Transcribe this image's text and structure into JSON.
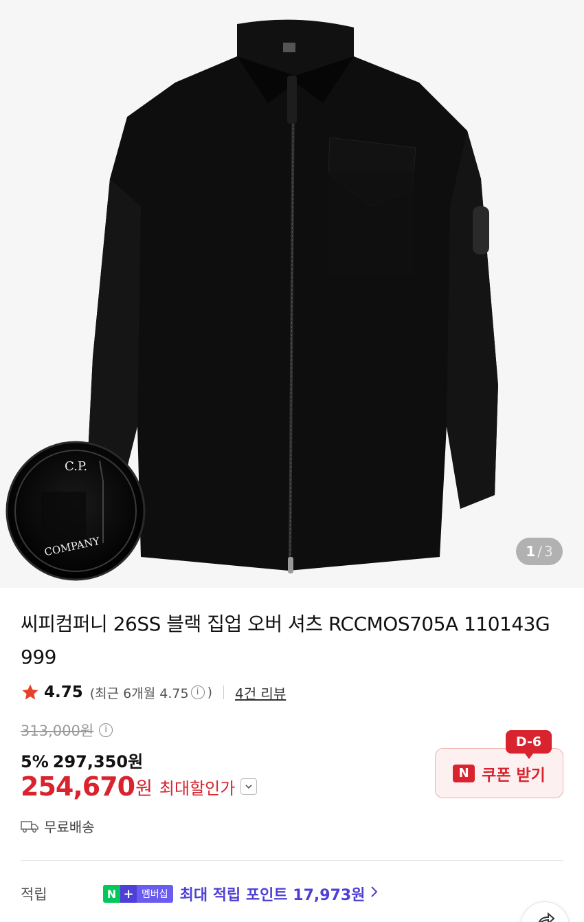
{
  "hero": {
    "image_alt": "black zip overshirt",
    "lens_brand_top": "C.P.",
    "lens_brand_bottom": "COMPANY",
    "page_current": "1",
    "page_separator": "/",
    "page_total": "3"
  },
  "product": {
    "title": "씨피컴퍼니 26SS 블랙 집업 오버 셔츠 RCCMOS705A 110143G 999",
    "rating": "4.75",
    "recent_prefix": "(최근 6개월 4.75",
    "recent_suffix": ")",
    "review_count": "4건 리뷰",
    "original_price": "313,000원",
    "discount_pct": "5%",
    "sale_price": "297,350원",
    "max_price": "254,670",
    "max_price_won": "원",
    "max_label": "최대할인가",
    "shipping": "무료배송"
  },
  "coupon": {
    "dday": "D-6",
    "badge": "N",
    "label": "쿠폰 받기"
  },
  "points": {
    "label": "적립",
    "badge_n": "N",
    "badge_plus": "+",
    "badge_membership": "멤버십",
    "text": "최대 적립 포인트 17,973원"
  },
  "colors": {
    "accent_red": "#d9232e",
    "naver_green": "#03c75a",
    "membership_purple": "#4e3fd6"
  },
  "icons": [
    "star-icon",
    "info-icon",
    "chevron-down-icon",
    "truck-icon",
    "chevron-right-icon",
    "share-icon"
  ]
}
